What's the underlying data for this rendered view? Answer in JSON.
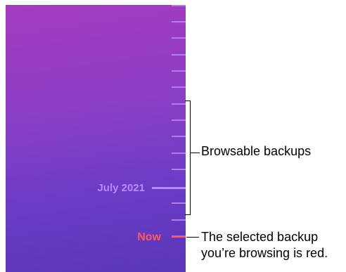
{
  "timeline": {
    "date_label": "July 2021",
    "now_label": "Now",
    "colors": {
      "selected": "#ff5a5a",
      "tick": "#b07ee8",
      "label": "#b48cf5"
    }
  },
  "annotations": {
    "browsable": "Browsable backups",
    "selected_line1": "The selected backup",
    "selected_line2": "you’re browsing is red."
  }
}
